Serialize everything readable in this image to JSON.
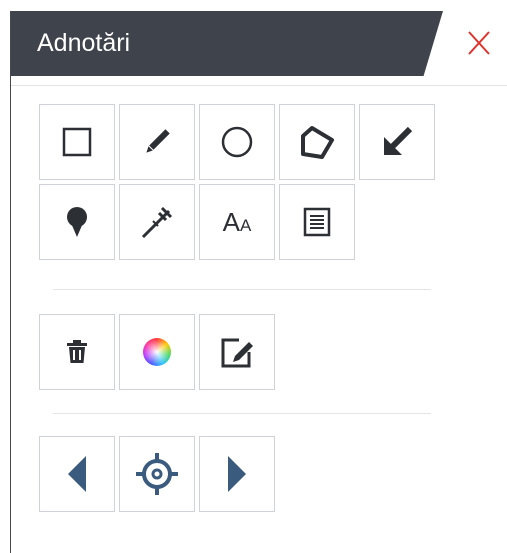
{
  "panel": {
    "title": "Adnotări",
    "close_icon": "close-x-icon",
    "accent_color": "#e0322c",
    "header_color": "#3f434b",
    "icon_color": "#3a5a7e"
  },
  "tools": [
    {
      "name": "rectangle-tool",
      "icon": "square-outline-icon"
    },
    {
      "name": "pencil-tool",
      "icon": "pencil-icon"
    },
    {
      "name": "circle-tool",
      "icon": "circle-outline-icon"
    },
    {
      "name": "polygon-tool",
      "icon": "polygon-icon"
    },
    {
      "name": "arrow-tool",
      "icon": "arrow-down-left-icon"
    },
    {
      "name": "marker-tool",
      "icon": "map-pin-icon"
    },
    {
      "name": "measure-tool",
      "icon": "caliper-icon"
    },
    {
      "name": "text-tool",
      "icon": "text-size-icon",
      "text_big": "A",
      "text_small": "A"
    },
    {
      "name": "note-tool",
      "icon": "document-lines-icon"
    }
  ],
  "actions": [
    {
      "name": "delete-button",
      "icon": "trash-icon"
    },
    {
      "name": "color-button",
      "icon": "color-wheel-icon"
    },
    {
      "name": "edit-button",
      "icon": "edit-pencil-box-icon"
    }
  ],
  "navigation": [
    {
      "name": "previous-button",
      "icon": "triangle-left-icon"
    },
    {
      "name": "locate-button",
      "icon": "crosshair-target-icon"
    },
    {
      "name": "next-button",
      "icon": "triangle-right-icon"
    }
  ]
}
